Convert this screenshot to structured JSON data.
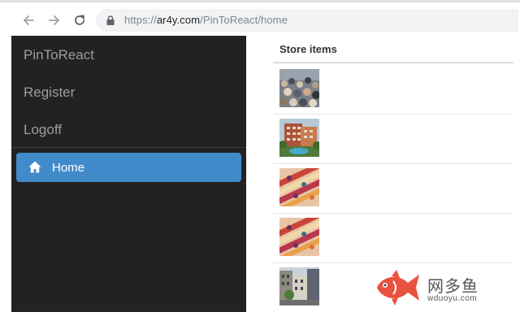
{
  "browser": {
    "url_scheme": "https://",
    "url_host": "ar4y.com",
    "url_path": "/PinToReact/home"
  },
  "sidebar": {
    "brand": "PinToReact",
    "links": [
      "Register",
      "Logoff"
    ],
    "active_item": {
      "label": "Home",
      "icon": "home-icon",
      "background": "#428bca"
    },
    "background": "#222222"
  },
  "store": {
    "header": "Store items",
    "rows": [
      {
        "thumbnail": "crowd-photo"
      },
      {
        "thumbnail": "hotel-building-photo"
      },
      {
        "thumbnail": "patterned-textile-photo"
      },
      {
        "thumbnail": "patterned-textile-photo"
      },
      {
        "thumbnail": "street-building-photo"
      }
    ]
  },
  "watermark": {
    "name": "网多鱼",
    "domain": "wduoyu.com",
    "color": "#e8533f"
  }
}
